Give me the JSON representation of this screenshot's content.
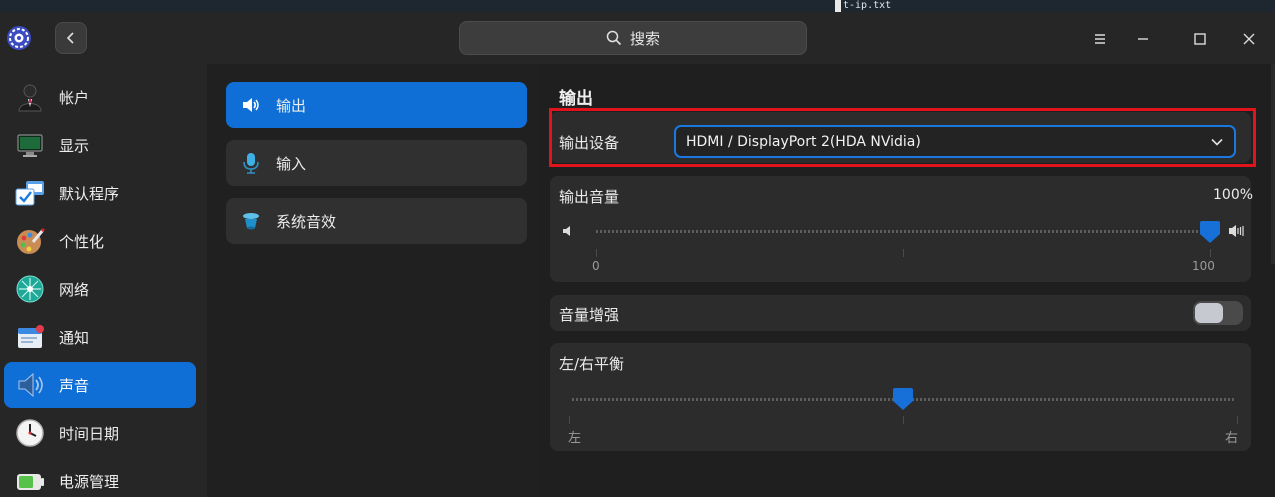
{
  "top_strip": {
    "file_label": "t-ip.txt"
  },
  "search": {
    "placeholder": "搜索"
  },
  "sidebar": {
    "items": [
      {
        "label": "帐户",
        "icon": "account-icon"
      },
      {
        "label": "显示",
        "icon": "display-icon"
      },
      {
        "label": "默认程序",
        "icon": "default-apps-icon"
      },
      {
        "label": "个性化",
        "icon": "personalization-icon"
      },
      {
        "label": "网络",
        "icon": "network-icon"
      },
      {
        "label": "通知",
        "icon": "notification-icon"
      },
      {
        "label": "声音",
        "icon": "sound-icon",
        "active": true
      },
      {
        "label": "时间日期",
        "icon": "clock-icon"
      },
      {
        "label": "电源管理",
        "icon": "battery-icon"
      }
    ]
  },
  "sound_tabs": [
    {
      "label": "输出",
      "icon": "speaker-icon",
      "active": true
    },
    {
      "label": "输入",
      "icon": "microphone-icon"
    },
    {
      "label": "系统音效",
      "icon": "system-sound-icon"
    }
  ],
  "output": {
    "title": "输出",
    "device_label": "输出设备",
    "device_value": "HDMI / DisplayPort 2(HDA NVidia)",
    "volume_label": "输出音量",
    "volume_percent_text": "100%",
    "volume_value": 1.0,
    "volume_min_label": "0",
    "volume_max_label": "100",
    "boost_label": "音量增强",
    "boost_enabled": false,
    "balance_label": "左/右平衡",
    "balance_value": 0.5,
    "balance_left_label": "左",
    "balance_right_label": "右"
  },
  "colors": {
    "accent": "#0f6fd6",
    "highlight_box": "#e0141a"
  }
}
